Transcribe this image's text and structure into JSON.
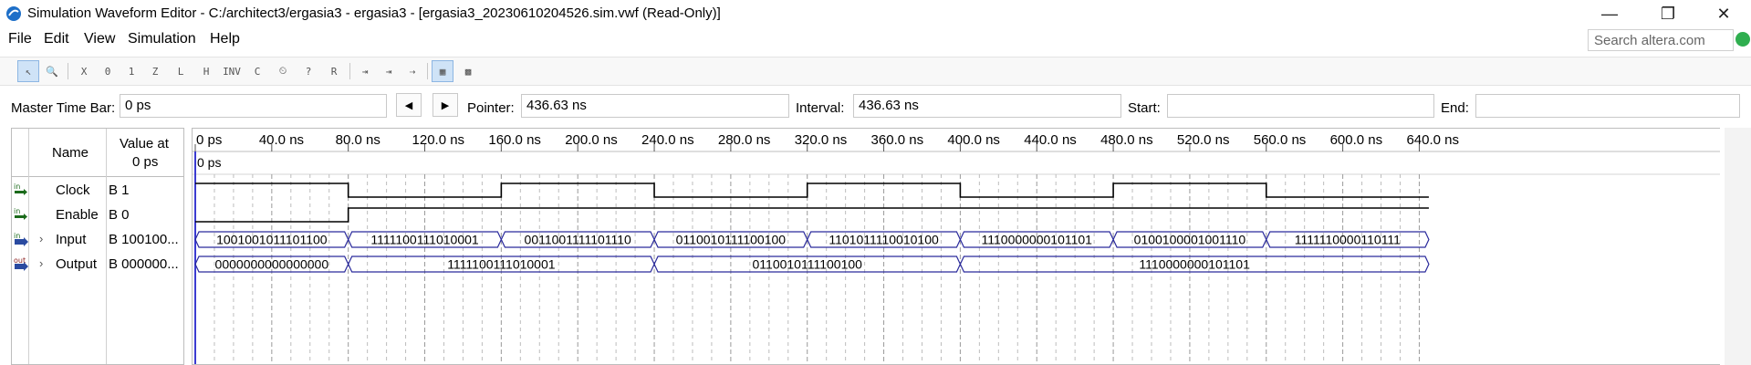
{
  "window": {
    "title": "Simulation Waveform Editor - C:/architect3/ergasia3 - ergasia3 - [ergasia3_20230610204526.sim.vwf (Read-Only)]",
    "controls": {
      "minimize": "—",
      "maximize": "❐",
      "close": "✕"
    }
  },
  "menu": {
    "items": [
      "File",
      "Edit",
      "View",
      "Simulation",
      "Help"
    ]
  },
  "search": {
    "placeholder": "Search altera.com"
  },
  "toolbar": {
    "buttons": [
      {
        "icon": "pointer-icon",
        "glyph": "↖",
        "active": true
      },
      {
        "icon": "zoom-icon",
        "glyph": "🔍",
        "active": false
      },
      {
        "icon": "force-unknown-icon",
        "glyph": "X",
        "active": false
      },
      {
        "icon": "force-low-icon",
        "glyph": "0",
        "active": false
      },
      {
        "icon": "force-high-icon",
        "glyph": "1",
        "active": false
      },
      {
        "icon": "force-high-impedance-icon",
        "glyph": "Z",
        "active": false
      },
      {
        "icon": "force-weak-low-icon",
        "glyph": "L",
        "active": false
      },
      {
        "icon": "force-weak-high-icon",
        "glyph": "H",
        "active": false
      },
      {
        "icon": "invert-icon",
        "glyph": "INV",
        "active": false
      },
      {
        "icon": "count-value-icon",
        "glyph": "C",
        "active": false
      },
      {
        "icon": "clock-icon",
        "glyph": "⏲",
        "active": false
      },
      {
        "icon": "arbitrary-value-icon",
        "glyph": "?",
        "active": false
      },
      {
        "icon": "random-value-icon",
        "glyph": "R",
        "active": false
      },
      {
        "icon": "run-functional-simulation-icon",
        "glyph": "⇥",
        "active": false
      },
      {
        "icon": "run-timing-simulation-icon",
        "glyph": "⇥",
        "active": false
      },
      {
        "icon": "generate-netlist-icon",
        "glyph": "⇢",
        "active": false
      },
      {
        "icon": "snap-to-grid-icon",
        "glyph": "▦",
        "active": true
      },
      {
        "icon": "group-icon",
        "glyph": "▩",
        "active": false
      }
    ]
  },
  "timebar": {
    "master_label": "Master Time Bar:",
    "master_value": "0 ps",
    "prev_glyph": "◀",
    "next_glyph": "▶",
    "pointer_label": "Pointer:",
    "pointer_value": "436.63 ns",
    "interval_label": "Interval:",
    "interval_value": "436.63 ns",
    "start_label": "Start:",
    "start_value": "",
    "end_label": "End:",
    "end_value": ""
  },
  "signal_table": {
    "name_header": "Name",
    "value_header_line1": "Value at",
    "value_header_line2": "0 ps",
    "signals": [
      {
        "name": "Clock",
        "value": "B 1",
        "type": "in",
        "expandable": false
      },
      {
        "name": "Enable",
        "value": "B 0",
        "type": "in",
        "expandable": false
      },
      {
        "name": "Input",
        "value": "B 100100...",
        "type": "in-bus",
        "expandable": true
      },
      {
        "name": "Output",
        "value": "B 000000...",
        "type": "out-bus",
        "expandable": true
      }
    ]
  },
  "waveform": {
    "cursor_label": "0 ps",
    "time_ticks": [
      "0 ps",
      "40.0 ns",
      "80.0 ns",
      "120.0 ns",
      "160.0 ns",
      "200.0 ns",
      "240.0 ns",
      "280.0 ns",
      "320.0 ns",
      "360.0 ns",
      "400.0 ns",
      "440.0 ns",
      "480.0 ns",
      "520.0 ns",
      "560.0 ns",
      "600.0 ns",
      "640.0 ns"
    ],
    "tick_ns": [
      0,
      40,
      80,
      120,
      160,
      200,
      240,
      280,
      320,
      360,
      400,
      440,
      480,
      520,
      560,
      600,
      640
    ],
    "grid_step_ns": 10,
    "range_ns": [
      0,
      645
    ],
    "clock": [
      [
        0,
        80,
        1
      ],
      [
        80,
        160,
        0
      ],
      [
        160,
        240,
        1
      ],
      [
        240,
        320,
        0
      ],
      [
        320,
        400,
        1
      ],
      [
        400,
        480,
        0
      ],
      [
        480,
        560,
        1
      ],
      [
        560,
        645,
        0
      ]
    ],
    "enable": [
      [
        0,
        80,
        0
      ],
      [
        80,
        645,
        1
      ]
    ],
    "input": [
      {
        "start": 0,
        "end": 80,
        "value": "1001001011101100"
      },
      {
        "start": 80,
        "end": 160,
        "value": "1111100111010001"
      },
      {
        "start": 160,
        "end": 240,
        "value": "0011001111101110"
      },
      {
        "start": 240,
        "end": 320,
        "value": "0110010111100100"
      },
      {
        "start": 320,
        "end": 400,
        "value": "1101011110010100"
      },
      {
        "start": 400,
        "end": 480,
        "value": "1110000000101101"
      },
      {
        "start": 480,
        "end": 560,
        "value": "0100100001001110"
      },
      {
        "start": 560,
        "end": 645,
        "value": "1111110000110111"
      }
    ],
    "output": [
      {
        "start": 0,
        "end": 80,
        "value": "0000000000000000"
      },
      {
        "start": 80,
        "end": 240,
        "value": "1111100111010001"
      },
      {
        "start": 240,
        "end": 400,
        "value": "0110010111100100"
      },
      {
        "start": 400,
        "end": 645,
        "value": "1110000000101101"
      }
    ],
    "colors": {
      "bus": "#2a2a9c",
      "signal": "#000000",
      "cursor": "#3b3bd1",
      "grid": "#bdbdbd"
    }
  }
}
